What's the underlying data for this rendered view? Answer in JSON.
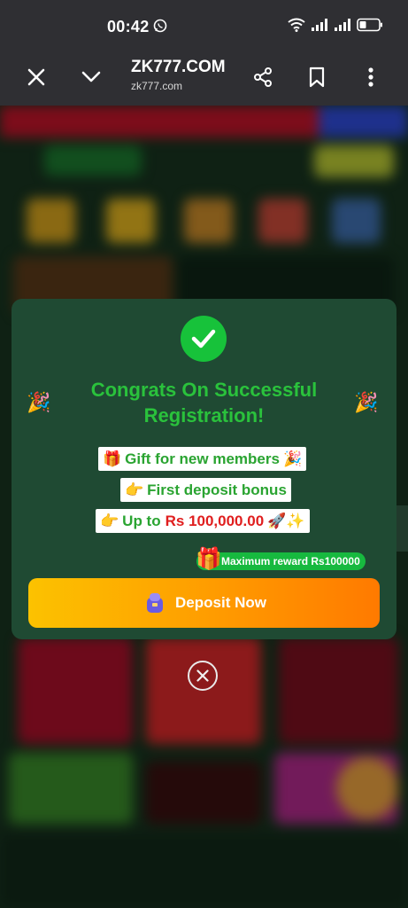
{
  "status_bar": {
    "time": "00:42"
  },
  "browser": {
    "title": "ZK777.COM",
    "url": "zk777.com"
  },
  "dialog": {
    "heading": "Congrats On Successful Registration!",
    "chip1": {
      "emoji_left": "🎁",
      "text": "Gift for new members",
      "emoji_right": "🎉"
    },
    "chip2": {
      "emoji_left": "👉",
      "text": "First deposit bonus"
    },
    "chip3": {
      "emoji_left": "👉",
      "text_prefix": "Up to",
      "amount": "Rs 100,000.00",
      "emoji_right": "🚀✨"
    },
    "max_reward": "Maximum reward Rs100000",
    "deposit_button": "Deposit Now",
    "party_emoji": "🎉"
  },
  "icons": [
    "whatsapp-icon",
    "wifi-icon",
    "signal-icon",
    "battery-icon",
    "close-icon",
    "chevron-down-icon",
    "share-icon",
    "bookmark-icon",
    "more-vert-icon",
    "check-icon",
    "gift-icon",
    "deposit-icon"
  ],
  "colors": {
    "accent_green": "#2ac23c",
    "dialog_bg": "#1f4a33",
    "button_start": "#fcc200",
    "button_end": "#ff7a00",
    "amount_red": "#e01e1e"
  }
}
